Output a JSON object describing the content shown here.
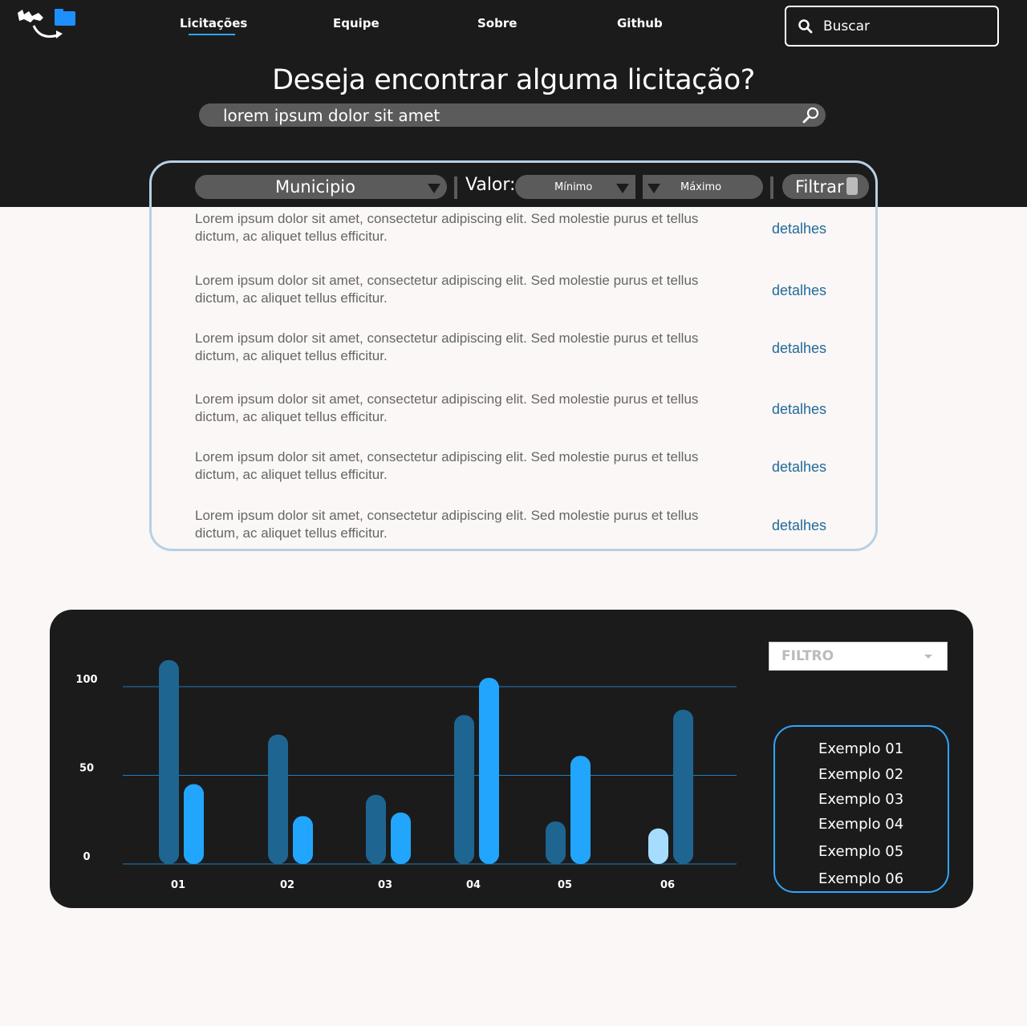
{
  "nav": {
    "items": [
      "Licitações",
      "Equipe",
      "Sobre",
      "Github"
    ],
    "active": "Licitações"
  },
  "top_search": {
    "placeholder": "Buscar"
  },
  "hero": {
    "title": "Deseja encontrar alguma licitação?",
    "search_value": "lorem ipsum dolor sit amet"
  },
  "filters": {
    "municipio": "Municipio",
    "valor_label": "Valor:",
    "minimo": "Mínimo",
    "maximo": "Máximo",
    "filtrar": "Filtrar"
  },
  "results": [
    {
      "text": "Lorem ipsum dolor sit amet, consectetur adipiscing elit. Sed molestie purus et tellus dictum, ac aliquet tellus efficitur.",
      "link": "detalhes"
    },
    {
      "text": "Lorem ipsum dolor sit amet, consectetur adipiscing elit. Sed molestie purus et tellus dictum, ac aliquet tellus efficitur.",
      "link": "detalhes"
    },
    {
      "text": "Lorem ipsum dolor sit amet, consectetur adipiscing elit. Sed molestie purus et tellus dictum, ac aliquet tellus efficitur.",
      "link": "detalhes"
    },
    {
      "text": "Lorem ipsum dolor sit amet, consectetur adipiscing elit. Sed molestie purus et tellus dictum, ac aliquet tellus efficitur.",
      "link": "detalhes"
    },
    {
      "text": "Lorem ipsum dolor sit amet, consectetur adipiscing elit. Sed molestie purus et tellus dictum, ac aliquet tellus efficitur.",
      "link": "detalhes"
    },
    {
      "text": "Lorem ipsum dolor sit amet, consectetur adipiscing elit. Sed molestie purus et tellus dictum, ac aliquet tellus efficitur.",
      "link": "detalhes"
    }
  ],
  "chart_filter": {
    "label": "FILTRO"
  },
  "legend": [
    "Exemplo 01",
    "Exemplo 02",
    "Exemplo 03",
    "Exemplo 04",
    "Exemplo 05",
    "Exemplo 06"
  ],
  "colors": {
    "dark_bar": "#1f6591",
    "bright_bar": "#22a6fd",
    "light_bar": "#a6dcfe",
    "grid": "#1f7ec2"
  },
  "chart_data": {
    "type": "bar",
    "categories": [
      "01",
      "02",
      "03",
      "04",
      "05",
      "06"
    ],
    "yticks": [
      0,
      50,
      100
    ],
    "ylim": [
      0,
      120
    ],
    "grid": true,
    "series": [
      {
        "values": [
          115,
          73,
          39,
          84,
          24,
          87
        ],
        "color": "#1f6591"
      },
      {
        "values": [
          45,
          27,
          29,
          105,
          61,
          20
        ],
        "color": "#22a6fd"
      }
    ],
    "special_colors": {
      "5-1": "#a6dcfe"
    },
    "order_swapped": [
      false,
      false,
      false,
      false,
      false,
      true
    ]
  }
}
